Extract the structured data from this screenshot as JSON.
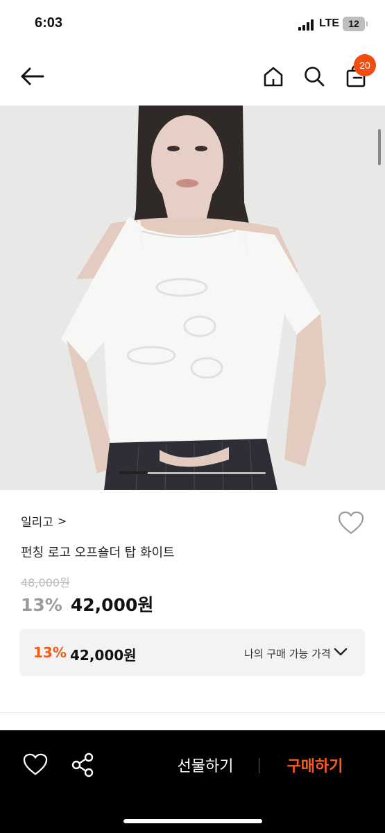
{
  "status_bar": {
    "time": "6:03",
    "network": "LTE",
    "battery": "12"
  },
  "nav": {
    "back_icon": "arrow-left-icon",
    "home_icon": "home-icon",
    "search_icon": "search-icon",
    "cart_icon": "shopping-bag-icon",
    "cart_badge": "20",
    "badge_color": "#f04e10"
  },
  "product": {
    "image_alt": "white off-shoulder top product photo",
    "carousel_progress": 0.2,
    "brand": "일리고",
    "brand_chevron": ">",
    "title": "펀칭 로고 오프숄더 탑 화이트",
    "original_price": "48,000원",
    "discount": "13%",
    "price": "42,000원",
    "wishlist_icon": "heart-outline-icon"
  },
  "my_price": {
    "discount": "13%",
    "price": "42,000원",
    "label": "나의 구매 가능 가격",
    "icon": "chevron-down-icon",
    "accent_color": "#ef5a1a"
  },
  "bottom_bar": {
    "heart_icon": "heart-outline-icon",
    "share_icon": "share-icon",
    "gift_label": "선물하기",
    "buy_label": "구매하기",
    "buy_color": "#ff5a1c"
  }
}
